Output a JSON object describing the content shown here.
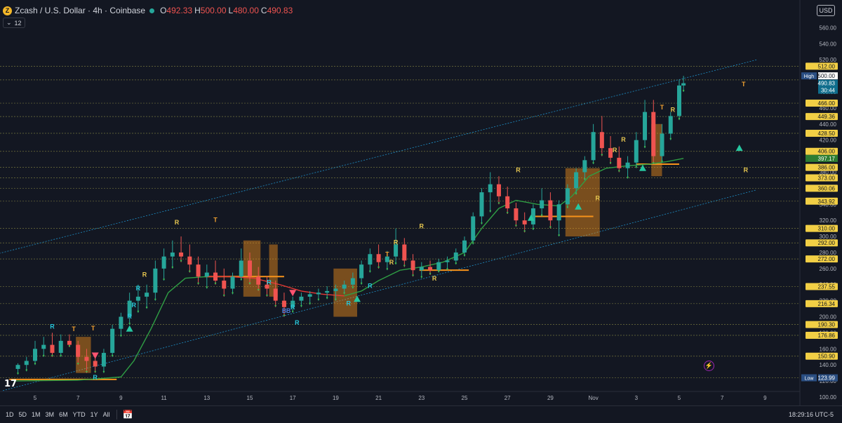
{
  "header": {
    "symbol": "Zcash / U.S. Dollar · 4h · Coinbase",
    "coin_glyph": "Z",
    "o_label": "O",
    "o_value": "492.33",
    "h_label": "H",
    "h_value": "500.00",
    "l_label": "L",
    "l_value": "480.00",
    "c_label": "C",
    "c_value": "490.83",
    "indicator_count": "12",
    "currency": "USD"
  },
  "colors": {
    "background": "#131722",
    "up": "#26a69a",
    "down": "#ef5350",
    "box": "#f7931a",
    "level_line": "#8b8a44",
    "channel": "#1e90c8",
    "signal_R": "#e6c650",
    "signal_T": "#f0a030",
    "signal_R_low": "#26c6da",
    "signal_B": "#4a7bd6",
    "trail_up": "#2f9e44",
    "trail_down": "#e53935",
    "label_bg": "#f2cf45",
    "label_text": "#131722",
    "last_price_bg": "#0f6d8c",
    "high_low_bg": "#2a4e82"
  },
  "bottom": {
    "ranges": [
      "1D",
      "5D",
      "1M",
      "3M",
      "6M",
      "YTD",
      "1Y",
      "All"
    ],
    "clock": "18:29:16 UTC-5",
    "calendar_icon": "calendar-icon"
  },
  "chart_data": {
    "type": "candlestick",
    "title": "",
    "timeframe": "4h",
    "x_ticks": [
      "5",
      "7",
      "9",
      "11",
      "13",
      "15",
      "17",
      "19",
      "21",
      "23",
      "25",
      "27",
      "29",
      "Nov",
      "3",
      "5",
      "7",
      "9"
    ],
    "y_ticks": [
      100,
      120,
      140,
      160,
      180,
      200,
      220,
      240,
      260,
      280,
      300,
      320,
      340,
      360,
      380,
      400,
      420,
      440,
      460,
      480,
      500,
      520,
      540,
      560
    ],
    "ylim": [
      100,
      570
    ],
    "grid": false,
    "price_labels": [
      512.0,
      466.0,
      449.36,
      428.5,
      406.0,
      386.0,
      373.0,
      360.06,
      343.92,
      310.0,
      292.0,
      272.0,
      237.55,
      216.34,
      190.3,
      176.86,
      150.9
    ],
    "special_labels": {
      "high": {
        "label": "High",
        "value": 500.0
      },
      "last_price": {
        "value": 490.83,
        "countdown": "30:44"
      },
      "trail": {
        "value": 397.17
      },
      "low": {
        "label": "Low",
        "value": 123.99
      }
    },
    "series": [
      {
        "kind": "ohlc",
        "points": [
          [
            4.2,
            135,
            142,
            128,
            140
          ],
          [
            4.6,
            140,
            150,
            132,
            145
          ],
          [
            5.0,
            145,
            170,
            140,
            160
          ],
          [
            5.4,
            160,
            175,
            150,
            165
          ],
          [
            5.8,
            165,
            180,
            150,
            155
          ],
          [
            6.2,
            155,
            178,
            150,
            170
          ],
          [
            6.6,
            170,
            178,
            162,
            165
          ],
          [
            7.0,
            165,
            170,
            140,
            150
          ],
          [
            7.4,
            150,
            160,
            130,
            145
          ],
          [
            7.8,
            145,
            150,
            130,
            138
          ],
          [
            8.2,
            138,
            160,
            130,
            155
          ],
          [
            8.6,
            155,
            190,
            150,
            185
          ],
          [
            9.0,
            185,
            205,
            175,
            200
          ],
          [
            9.4,
            200,
            230,
            190,
            220
          ],
          [
            9.8,
            220,
            240,
            205,
            225
          ],
          [
            10.2,
            225,
            240,
            210,
            230
          ],
          [
            10.6,
            230,
            270,
            220,
            260
          ],
          [
            11.0,
            260,
            285,
            245,
            275
          ],
          [
            11.4,
            275,
            295,
            260,
            280
          ],
          [
            11.8,
            280,
            300,
            268,
            275
          ],
          [
            12.2,
            275,
            290,
            255,
            265
          ],
          [
            12.6,
            265,
            275,
            240,
            250
          ],
          [
            13.0,
            250,
            265,
            235,
            255
          ],
          [
            13.4,
            255,
            270,
            240,
            245
          ],
          [
            13.8,
            245,
            260,
            225,
            235
          ],
          [
            14.2,
            235,
            255,
            228,
            250
          ],
          [
            14.6,
            250,
            285,
            245,
            270
          ],
          [
            15.0,
            270,
            280,
            240,
            250
          ],
          [
            15.4,
            250,
            262,
            232,
            240
          ],
          [
            15.8,
            240,
            250,
            225,
            235
          ],
          [
            16.2,
            235,
            245,
            212,
            220
          ],
          [
            16.6,
            220,
            230,
            200,
            212
          ],
          [
            17.0,
            212,
            225,
            205,
            220
          ],
          [
            17.4,
            220,
            230,
            212,
            225
          ],
          [
            17.8,
            225,
            232,
            215,
            228
          ],
          [
            18.2,
            228,
            235,
            220,
            230
          ],
          [
            18.6,
            230,
            238,
            222,
            232
          ],
          [
            19.0,
            232,
            240,
            220,
            235
          ],
          [
            19.4,
            235,
            245,
            228,
            240
          ],
          [
            19.8,
            240,
            255,
            235,
            248
          ],
          [
            20.2,
            248,
            270,
            240,
            265
          ],
          [
            20.6,
            265,
            285,
            255,
            278
          ],
          [
            21.0,
            278,
            290,
            260,
            268
          ],
          [
            21.4,
            268,
            282,
            258,
            275
          ],
          [
            21.8,
            275,
            310,
            265,
            290
          ],
          [
            22.2,
            290,
            298,
            262,
            270
          ],
          [
            22.6,
            270,
            278,
            250,
            258
          ],
          [
            23.0,
            258,
            268,
            248,
            262
          ],
          [
            23.4,
            262,
            270,
            252,
            258
          ],
          [
            23.8,
            258,
            272,
            255,
            268
          ],
          [
            24.2,
            268,
            275,
            258,
            270
          ],
          [
            24.6,
            270,
            285,
            265,
            280
          ],
          [
            25.0,
            280,
            300,
            275,
            295
          ],
          [
            25.4,
            295,
            330,
            290,
            325
          ],
          [
            25.8,
            325,
            360,
            315,
            355
          ],
          [
            26.2,
            355,
            380,
            330,
            365
          ],
          [
            26.6,
            365,
            375,
            340,
            350
          ],
          [
            27.0,
            350,
            362,
            328,
            335
          ],
          [
            27.4,
            335,
            342,
            312,
            320
          ],
          [
            27.8,
            320,
            330,
            305,
            315
          ],
          [
            28.2,
            315,
            340,
            308,
            335
          ],
          [
            28.6,
            335,
            360,
            325,
            345
          ],
          [
            29.0,
            345,
            355,
            310,
            320
          ],
          [
            29.4,
            320,
            345,
            300,
            340
          ],
          [
            29.8,
            340,
            365,
            335,
            360
          ],
          [
            30.2,
            360,
            385,
            352,
            380
          ],
          [
            30.6,
            380,
            400,
            370,
            395
          ],
          [
            31.0,
            395,
            440,
            390,
            430
          ],
          [
            31.4,
            430,
            450,
            400,
            410
          ],
          [
            31.8,
            410,
            425,
            390,
            398
          ],
          [
            32.2,
            398,
            412,
            380,
            385
          ],
          [
            32.6,
            385,
            400,
            372,
            392
          ],
          [
            33.0,
            392,
            430,
            385,
            420
          ],
          [
            33.4,
            420,
            470,
            410,
            455
          ],
          [
            33.8,
            455,
            470,
            390,
            400
          ],
          [
            34.2,
            400,
            440,
            392,
            428
          ],
          [
            34.6,
            428,
            455,
            420,
            450
          ],
          [
            35.0,
            450,
            495,
            445,
            488
          ],
          [
            35.2,
            488,
            500,
            480,
            490.83
          ]
        ]
      },
      {
        "kind": "trail",
        "name": "",
        "points": [
          [
            4.0,
            120
          ],
          [
            7.0,
            121
          ],
          [
            9.0,
            125
          ],
          [
            9.6,
            145
          ],
          [
            10.4,
            185
          ],
          [
            11.2,
            230
          ],
          [
            12.0,
            248
          ],
          [
            13.0,
            250
          ],
          [
            14.0,
            250
          ],
          [
            15.2,
            248
          ],
          [
            16.4,
            240
          ],
          [
            17.4,
            232
          ],
          [
            18.4,
            228
          ],
          [
            19.4,
            226
          ],
          [
            20.2,
            232
          ],
          [
            21.0,
            245
          ],
          [
            22.0,
            258
          ],
          [
            23.0,
            262
          ],
          [
            24.0,
            268
          ],
          [
            25.0,
            280
          ],
          [
            25.8,
            310
          ],
          [
            26.6,
            335
          ],
          [
            27.4,
            345
          ],
          [
            28.4,
            340
          ],
          [
            29.4,
            338
          ],
          [
            30.0,
            350
          ],
          [
            30.8,
            375
          ],
          [
            31.6,
            385
          ],
          [
            32.6,
            388
          ],
          [
            33.6,
            390
          ],
          [
            34.4,
            393
          ],
          [
            35.2,
            397.17
          ]
        ]
      },
      {
        "kind": "levels",
        "values": [
          512,
          495,
          466,
          449.36,
          428.5,
          406,
          386,
          373,
          360.06,
          343.92,
          310,
          292,
          272,
          237.55,
          216.34,
          190.3,
          176.86,
          150.9,
          123.99
        ]
      },
      {
        "kind": "channel",
        "upper": [
          [
            3.2,
            278
          ],
          [
            38.6,
            520
          ]
        ],
        "lower": [
          [
            3.5,
            108
          ],
          [
            38.6,
            358
          ]
        ]
      },
      {
        "kind": "zones",
        "boxes": [
          [
            6.9,
            7.6,
            130,
            175
          ],
          [
            14.7,
            15.5,
            225,
            295
          ],
          [
            15.9,
            16.3,
            225,
            290
          ],
          [
            18.9,
            20.0,
            200,
            260
          ],
          [
            29.7,
            31.3,
            300,
            385
          ],
          [
            33.7,
            34.2,
            375,
            440
          ]
        ],
        "support_lines": [
          [
            3.8,
            8.8,
            122
          ],
          [
            12.9,
            16.6,
            250
          ],
          [
            22.9,
            25.2,
            258
          ],
          [
            28.2,
            31.0,
            325
          ],
          [
            33.0,
            35.0,
            390
          ]
        ]
      },
      {
        "kind": "signals",
        "items": [
          [
            5.8,
            185,
            "R"
          ],
          [
            6.8,
            182,
            "T"
          ],
          [
            7.7,
            183,
            "T"
          ],
          [
            9.4,
            198,
            "R"
          ],
          [
            9.6,
            212,
            "R"
          ],
          [
            9.8,
            233,
            "R"
          ],
          [
            10.1,
            250,
            "R"
          ],
          [
            11.6,
            315,
            "R"
          ],
          [
            13.4,
            318,
            "T"
          ],
          [
            19.6,
            214,
            "R"
          ],
          [
            17.0,
            209,
            "R"
          ],
          [
            16.6,
            205,
            "B"
          ],
          [
            16.8,
            205,
            "B"
          ],
          [
            17.2,
            190,
            "R"
          ],
          [
            20.6,
            236,
            "R"
          ],
          [
            21.4,
            275,
            "T"
          ],
          [
            21.6,
            265,
            "R"
          ],
          [
            21.8,
            290,
            "R"
          ],
          [
            23.0,
            310,
            "R"
          ],
          [
            23.6,
            245,
            "R"
          ],
          [
            27.5,
            380,
            "R"
          ],
          [
            31.2,
            345,
            "R"
          ],
          [
            32.0,
            405,
            "R"
          ],
          [
            32.4,
            418,
            "R"
          ],
          [
            34.2,
            458,
            "T"
          ],
          [
            34.7,
            455,
            "R"
          ],
          [
            38.1,
            380,
            "R"
          ],
          [
            38.0,
            487,
            "T"
          ],
          [
            7.8,
            122,
            "R"
          ],
          [
            15.9,
            240,
            "R"
          ]
        ]
      },
      {
        "kind": "arrows",
        "items": [
          [
            7.8,
            152,
            "down"
          ],
          [
            9.4,
            185,
            "up"
          ],
          [
            17.0,
            230,
            "down"
          ],
          [
            20.0,
            222,
            "up"
          ],
          [
            28.1,
            323,
            "up"
          ],
          [
            30.3,
            337,
            "up"
          ],
          [
            33.3,
            385,
            "up"
          ],
          [
            37.8,
            410,
            "up"
          ]
        ]
      }
    ]
  }
}
